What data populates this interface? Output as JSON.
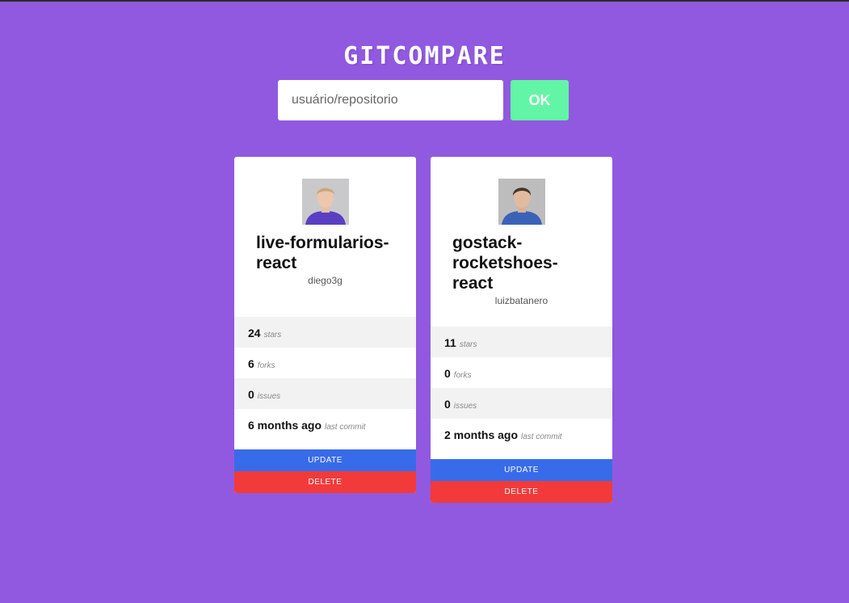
{
  "app": {
    "title": "GITCOMPARE"
  },
  "search": {
    "placeholder": "usuário/repositorio",
    "value": "",
    "submit_label": "OK"
  },
  "repositories": [
    {
      "name": "live-formularios-react",
      "owner": "diego3g",
      "stats": [
        {
          "value": "24",
          "label": "stars"
        },
        {
          "value": "6",
          "label": "forks"
        },
        {
          "value": "0",
          "label": "issues"
        },
        {
          "value": "6 months ago",
          "label": "last commit"
        }
      ],
      "update_label": "UPDATE",
      "delete_label": "DELETE"
    },
    {
      "name": "gostack-rocketshoes-react",
      "owner": "luizbatanero",
      "stats": [
        {
          "value": "11",
          "label": "stars"
        },
        {
          "value": "0",
          "label": "forks"
        },
        {
          "value": "0",
          "label": "issues"
        },
        {
          "value": "2 months ago",
          "label": "last commit"
        }
      ],
      "update_label": "UPDATE",
      "delete_label": "DELETE"
    }
  ],
  "colors": {
    "background": "#9159e0",
    "ok_button": "#63f5a6",
    "update_button": "#386bea",
    "delete_button": "#f23a3a"
  }
}
